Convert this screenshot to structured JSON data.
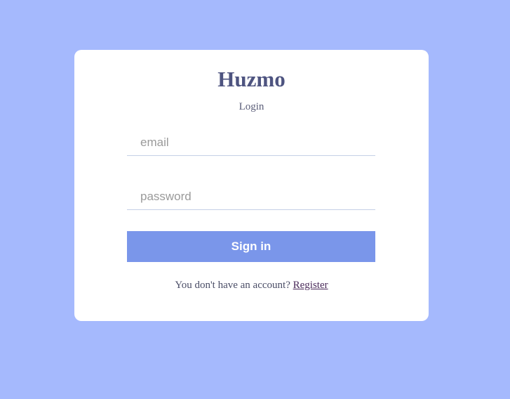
{
  "app": {
    "title": "Huzmo",
    "subtitle": "Login"
  },
  "form": {
    "email_placeholder": "email",
    "email_value": "",
    "password_placeholder": "password",
    "password_value": "",
    "submit_label": "Sign in"
  },
  "footer": {
    "prompt": "You don't have an account? ",
    "link_label": "Register"
  },
  "colors": {
    "background": "#a5b9fd",
    "card": "#ffffff",
    "button": "#7a96ea",
    "title": "#4e5480"
  }
}
